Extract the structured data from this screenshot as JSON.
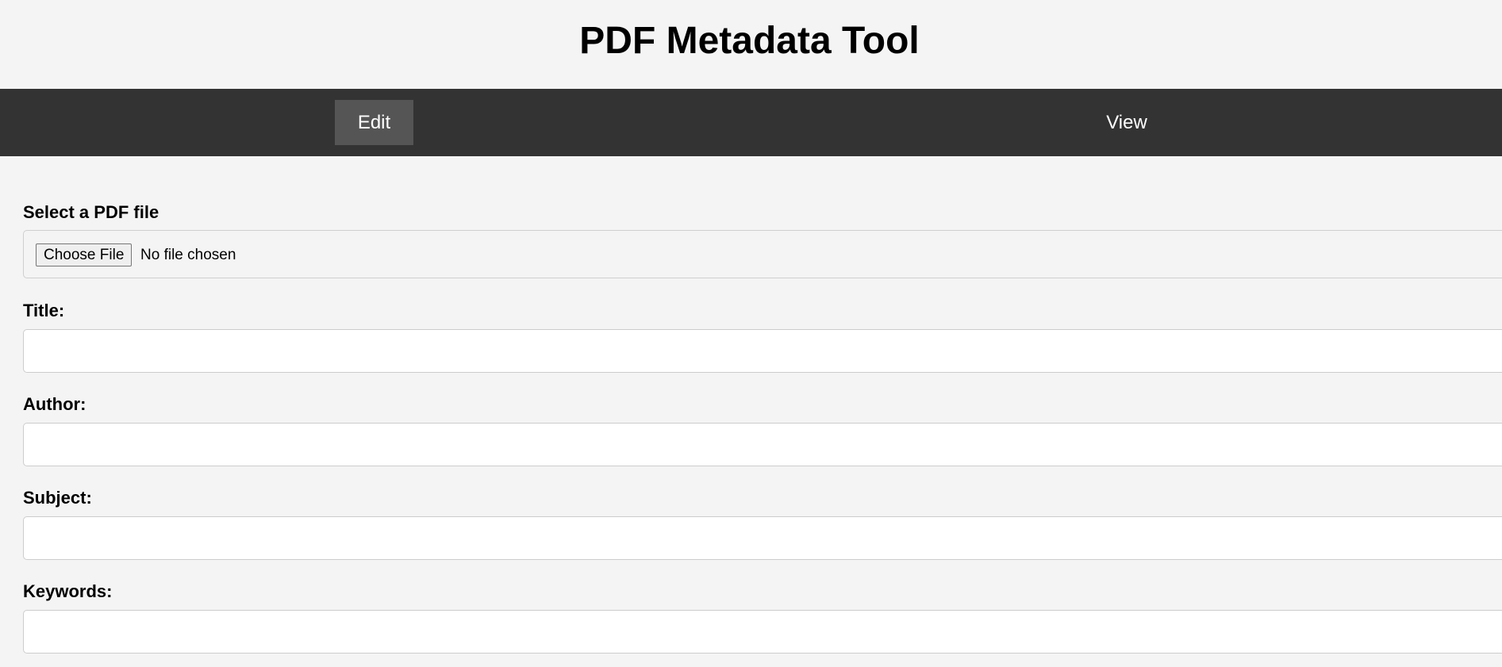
{
  "header": {
    "title": "PDF Metadata Tool"
  },
  "nav": {
    "items": [
      {
        "label": "Edit",
        "active": true
      },
      {
        "label": "View",
        "active": false
      }
    ]
  },
  "form": {
    "file": {
      "label": "Select a PDF file",
      "button_label": "Choose File",
      "status": "No file chosen"
    },
    "fields": [
      {
        "label": "Title:",
        "value": "",
        "placeholder": ""
      },
      {
        "label": "Author:",
        "value": "",
        "placeholder": ""
      },
      {
        "label": "Subject:",
        "value": "",
        "placeholder": ""
      },
      {
        "label": "Keywords:",
        "value": "",
        "placeholder": ""
      }
    ]
  },
  "colors": {
    "background": "#f4f4f4",
    "navbar": "#333333",
    "nav_active": "#555555",
    "nav_text": "#ffffff"
  }
}
